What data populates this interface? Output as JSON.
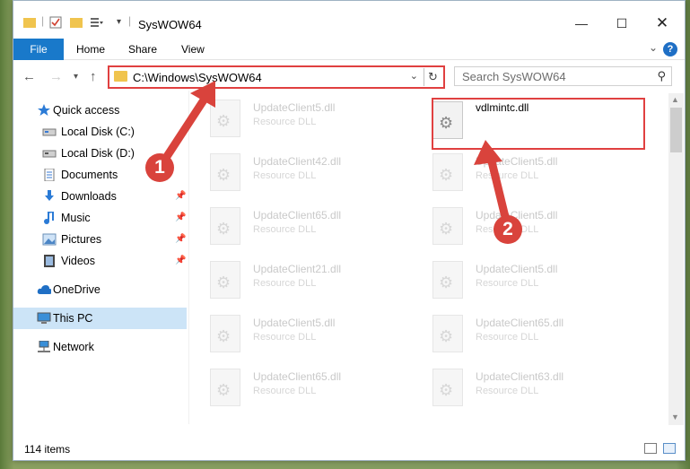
{
  "window": {
    "title": "SysWOW64"
  },
  "ribbon": {
    "tabs": [
      "File",
      "Home",
      "Share",
      "View"
    ],
    "help": "?"
  },
  "nav": {
    "address": "C:\\Windows\\SysWOW64",
    "search_placeholder": "Search SysWOW64"
  },
  "sidebar": {
    "items": [
      {
        "label": "Quick access",
        "icon": "star-icon"
      },
      {
        "label": "Local Disk (C:)",
        "icon": "drive-icon"
      },
      {
        "label": "Local Disk (D:)",
        "icon": "drive-icon"
      },
      {
        "label": "Documents",
        "icon": "documents-icon"
      },
      {
        "label": "Downloads",
        "icon": "downloads-icon"
      },
      {
        "label": "Music",
        "icon": "music-icon"
      },
      {
        "label": "Pictures",
        "icon": "pictures-icon"
      },
      {
        "label": "Videos",
        "icon": "videos-icon"
      },
      {
        "label": "OneDrive",
        "icon": "cloud-icon"
      },
      {
        "label": "This PC",
        "icon": "computer-icon"
      },
      {
        "label": "Network",
        "icon": "network-icon"
      }
    ]
  },
  "files": [
    {
      "name": "UpdateClient5.dll",
      "type": "Resource DLL"
    },
    {
      "name": "vdlmintc.dll",
      "type": ""
    },
    {
      "name": "UpdateClient42.dll",
      "type": "Resource DLL"
    },
    {
      "name": "UpdateClient5.dll",
      "type": "Resource DLL"
    },
    {
      "name": "UpdateClient65.dll",
      "type": "Resource DLL"
    },
    {
      "name": "UpdateClient5.dll",
      "type": "Resource DLL"
    },
    {
      "name": "UpdateClient21.dll",
      "type": "Resource DLL"
    },
    {
      "name": "UpdateClient5.dll",
      "type": "Resource DLL"
    },
    {
      "name": "UpdateClient5.dll",
      "type": "Resource DLL"
    },
    {
      "name": "UpdateClient65.dll",
      "type": "Resource DLL"
    },
    {
      "name": "UpdateClient65.dll",
      "type": "Resource DLL"
    },
    {
      "name": "UpdateClient63.dll",
      "type": "Resource DLL"
    }
  ],
  "status": {
    "item_count": "114 items"
  },
  "callouts": [
    "1",
    "2"
  ],
  "colors": {
    "accent": "#1979ca",
    "highlight": "#e04040",
    "selected": "#cce4f7"
  }
}
